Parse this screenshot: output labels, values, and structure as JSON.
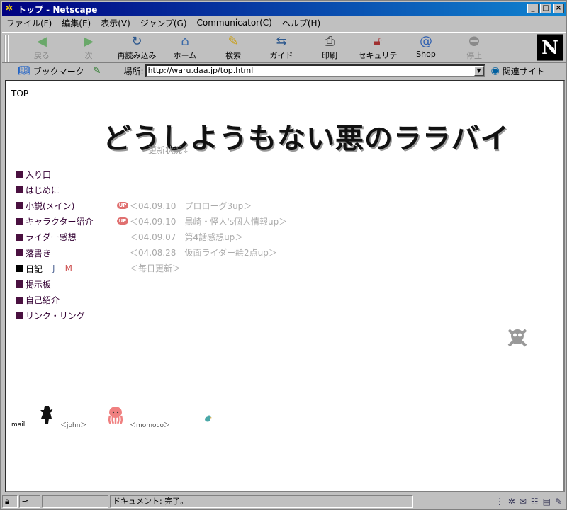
{
  "window": {
    "title": "トップ - Netscape"
  },
  "menubar": [
    "ファイル(F)",
    "編集(E)",
    "表示(V)",
    "ジャンプ(G)",
    "Communicator(C)",
    "ヘルプ(H)"
  ],
  "toolbar": {
    "back": "戻る",
    "forward": "次",
    "reload": "再読み込み",
    "home": "ホーム",
    "search": "検索",
    "guide": "ガイド",
    "print": "印刷",
    "security": "セキュリティ",
    "shop": "Shop",
    "stop": "停止",
    "logo": "N"
  },
  "locbar": {
    "bookmarks": "ブックマーク",
    "location_label": "場所:",
    "url": "http://waru.daa.jp/top.html",
    "related": "関連サイト"
  },
  "page": {
    "top_label": "TOP",
    "title": "どうしようもない悪のララバイ",
    "update_label": "更新状況↓",
    "menu": [
      "入り口",
      "はじめに",
      "小説(メイン)",
      "キャラクター紹介",
      "ライダー感想",
      "落書き",
      "日記",
      "掲示板",
      "自己紹介",
      "リンク・リング"
    ],
    "diary_j": "J",
    "diary_m": "M",
    "up_badge": "UP",
    "news": [
      "＜04.09.10　プロローグ3up＞",
      "＜04.09.10　黒崎・怪人's個人情報up＞",
      "＜04.09.07　第4話感想up＞",
      "＜04.08.28　仮面ライダー絵2点up＞",
      "＜毎日更新＞"
    ],
    "footer": {
      "mail": "mail",
      "john": "＜john＞",
      "momoco": "＜momoco＞"
    }
  },
  "status": {
    "text": "ドキュメント: 完了。"
  },
  "colors": {
    "title_bar": "#000080",
    "menu_square": "#4a1040",
    "news_text": "#aaaaaa"
  }
}
